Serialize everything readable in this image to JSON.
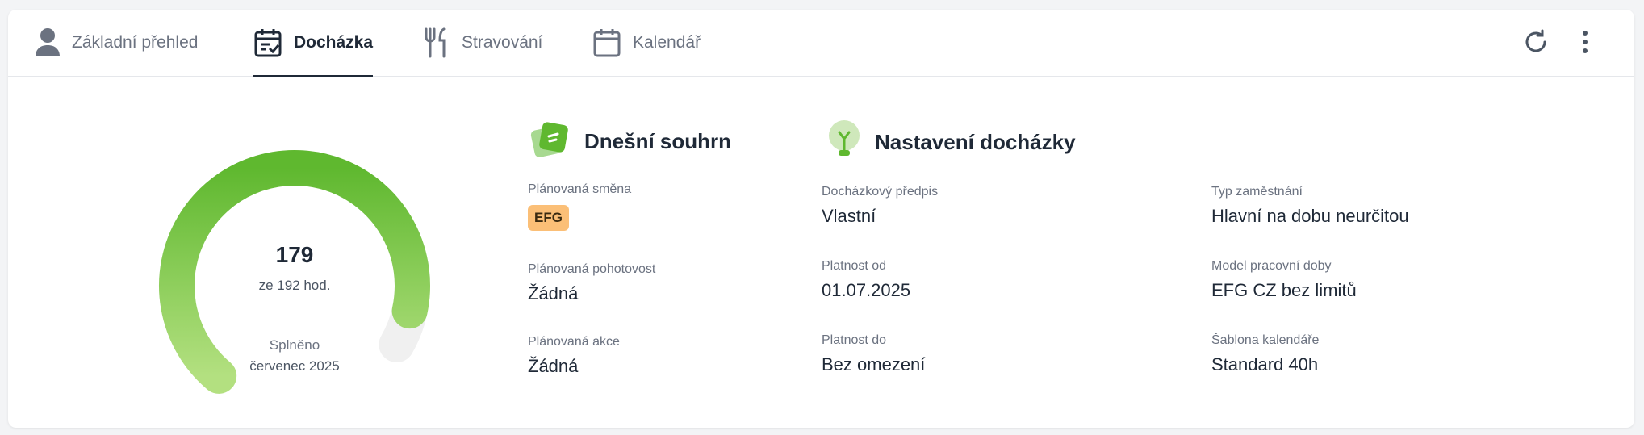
{
  "tabs": [
    {
      "label": "Základní přehled",
      "icon": "person-icon"
    },
    {
      "label": "Docházka",
      "icon": "calendar-check-icon",
      "active": true
    },
    {
      "label": "Stravování",
      "icon": "fork-knife-icon"
    },
    {
      "label": "Kalendář",
      "icon": "calendar-icon"
    }
  ],
  "toolbar": {
    "refresh_icon": "refresh-icon",
    "more_icon": "more-vertical-icon"
  },
  "gauge": {
    "value": "179",
    "subtitle": "ze 192 hod.",
    "status": "Splněno",
    "period": "červenec 2025",
    "fraction": 0.932,
    "color_start": "#b3e080",
    "color_end": "#5fb82f",
    "track_color": "#f0f0f0"
  },
  "summary": {
    "title": "Dnešní souhrn",
    "icon": "note-cards-icon",
    "fields": [
      {
        "label": "Plánovaná směna",
        "badge": "EFG"
      },
      {
        "label": "Plánovaná pohotovost",
        "value": "Žádná"
      },
      {
        "label": "Plánovaná akce",
        "value": "Žádná"
      }
    ]
  },
  "settings": {
    "title": "Nastavení docházky",
    "icon": "lightbulb-icon",
    "col1": [
      {
        "label": "Docházkový předpis",
        "value": "Vlastní"
      },
      {
        "label": "Platnost od",
        "value": "01.07.2025"
      },
      {
        "label": "Platnost do",
        "value": "Bez omezení"
      }
    ],
    "col2": [
      {
        "label": "Typ zaměstnání",
        "value": "Hlavní na dobu neurčitou"
      },
      {
        "label": "Model pracovní doby",
        "value": "EFG CZ bez limitů"
      },
      {
        "label": "Šablona kalendáře",
        "value": "Standard 40h"
      }
    ]
  },
  "colors": {
    "accent": "#1f2937",
    "badge": "#fbbf77",
    "green": "#5fb82f"
  }
}
